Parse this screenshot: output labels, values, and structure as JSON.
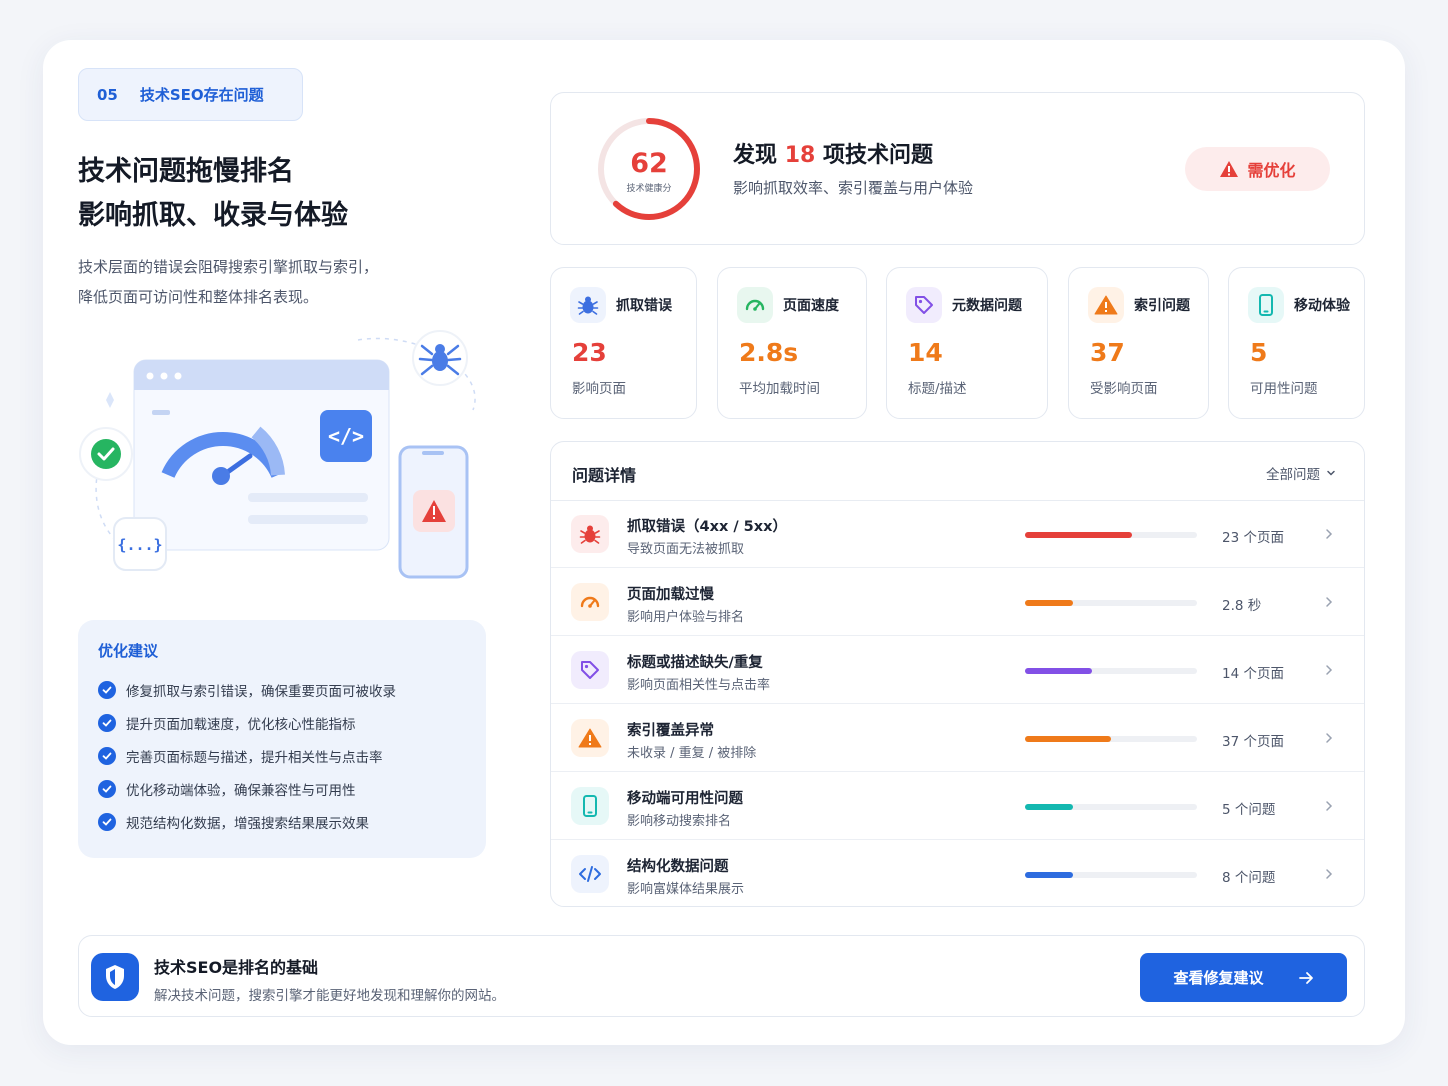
{
  "colors": {
    "brand": "#1f63e0",
    "danger": "#e5403a",
    "orange": "#ef7a1a",
    "purple": "#8250e6",
    "teal": "#14b8b0",
    "blue": "#2d6cdf"
  },
  "section": {
    "number": "05",
    "label": "技术SEO存在问题"
  },
  "headline": {
    "line1": "技术问题拖慢排名",
    "line2": "影响抓取、收录与体验"
  },
  "description": {
    "line1": "技术层面的错误会阻碍搜索引擎抓取与索引，",
    "line2": "降低页面可访问性和整体排名表现。"
  },
  "illustration": {
    "code_label": "{...}"
  },
  "tips": {
    "title": "优化建议",
    "items": [
      "修复抓取与索引错误，确保重要页面可被收录",
      "提升页面加载速度，优化核心性能指标",
      "完善页面标题与描述，提升相关性与点击率",
      "优化移动端体验，确保兼容性与可用性",
      "规范结构化数据，增强搜索结果展示效果"
    ]
  },
  "summary": {
    "score": "62",
    "score_value": 62,
    "score_label": "技术健康分",
    "title_prefix": "发现",
    "issue_count": "18",
    "title_suffix": "项技术问题",
    "subtitle": "影响抓取效率、索引覆盖与用户体验",
    "badge": "需优化"
  },
  "metrics": [
    {
      "icon": "bug-icon",
      "label": "抓取错误",
      "value": "23",
      "sub": "影响页面",
      "color": "#e5403a",
      "bg": "#eef3fd"
    },
    {
      "icon": "speedometer-icon",
      "label": "页面速度",
      "value": "2.8s",
      "sub": "平均加载时间",
      "color": "#ef7a1a",
      "bg": "#e8f7ef"
    },
    {
      "icon": "tag-icon",
      "label": "元数据问题",
      "value": "14",
      "sub": "标题/描述",
      "color": "#ef7a1a",
      "bg": "#f1ecfd"
    },
    {
      "icon": "warning-icon",
      "label": "索引问题",
      "value": "37",
      "sub": "受影响页面",
      "color": "#ef7a1a",
      "bg": "#fff2e6"
    },
    {
      "icon": "mobile-icon",
      "label": "移动体验",
      "value": "5",
      "sub": "可用性问题",
      "color": "#ef7a1a",
      "bg": "#e6f8f7"
    }
  ],
  "details": {
    "title": "问题详情",
    "filter": "全部问题",
    "rows": [
      {
        "icon": "bug-icon",
        "title": "抓取错误（4xx / 5xx）",
        "sub": "导致页面无法被抓取",
        "progress": 0.62,
        "count": "23 个页面",
        "color": "#e5403a",
        "bg": "#fdecec"
      },
      {
        "icon": "speedometer-icon",
        "title": "页面加载过慢",
        "sub": "影响用户体验与排名",
        "progress": 0.28,
        "count": "2.8 秒",
        "color": "#ef7a1a",
        "bg": "#fff2e6"
      },
      {
        "icon": "tag-icon",
        "title": "标题或描述缺失/重复",
        "sub": "影响页面相关性与点击率",
        "progress": 0.39,
        "count": "14 个页面",
        "color": "#8250e6",
        "bg": "#f1ecfd"
      },
      {
        "icon": "warning-icon",
        "title": "索引覆盖异常",
        "sub": "未收录 / 重复 / 被排除",
        "progress": 0.5,
        "count": "37 个页面",
        "color": "#ef7a1a",
        "bg": "#fff2e6"
      },
      {
        "icon": "mobile-icon",
        "title": "移动端可用性问题",
        "sub": "影响移动搜索排名",
        "progress": 0.28,
        "count": "5 个问题",
        "color": "#14b8b0",
        "bg": "#e6f8f7"
      },
      {
        "icon": "code-icon",
        "title": "结构化数据问题",
        "sub": "影响富媒体结果展示",
        "progress": 0.28,
        "count": "8 个问题",
        "color": "#2d6cdf",
        "bg": "#eef3fd"
      }
    ]
  },
  "footer": {
    "title": "技术SEO是排名的基础",
    "subtitle": "解决技术问题，搜索引擎才能更好地发现和理解你的网站。",
    "button": "查看修复建议"
  }
}
